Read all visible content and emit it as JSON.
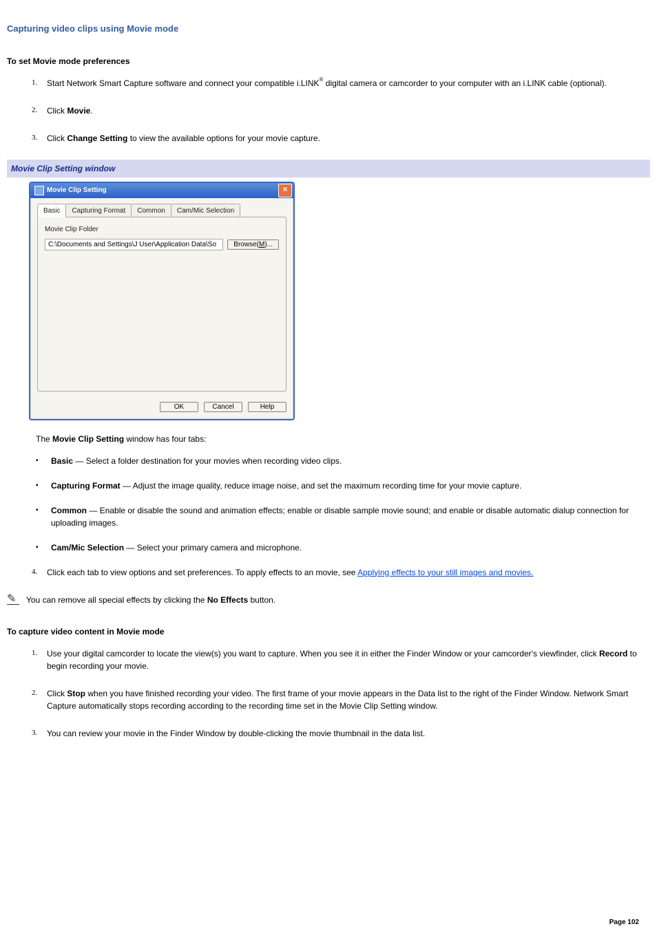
{
  "page_title": "Capturing video clips using Movie mode",
  "section1": {
    "heading": "To set Movie mode preferences",
    "step1_a": "Start Network Smart Capture software and connect your compatible i.LINK",
    "step1_reg": "®",
    "step1_b": " digital camera or camcorder to your computer with an i.LINK cable (optional).",
    "step2_a": "Click ",
    "step2_bold": "Movie",
    "step2_b": ".",
    "step3_a": "Click ",
    "step3_bold": "Change Setting",
    "step3_b": " to view the available options for your movie capture."
  },
  "caption": "Movie Clip Setting window",
  "dialog": {
    "title": "Movie Clip Setting",
    "tabs": {
      "t0": "Basic",
      "t1": "Capturing Format",
      "t2": "Common",
      "t3": "Cam/Mic Selection"
    },
    "group_label": "Movie Clip Folder",
    "folder_value": "C:\\Documents and Settings\\J User\\Application Data\\So",
    "browse_pre": "Browse(",
    "browse_u": "M",
    "browse_post": ")...",
    "ok": "OK",
    "cancel": "Cancel",
    "help": "Help"
  },
  "tabs_intro_a": "The ",
  "tabs_intro_bold": "Movie Clip Setting",
  "tabs_intro_b": " window has four tabs:",
  "tab_desc": {
    "basic_b": "Basic",
    "basic_t": " — Select a folder destination for your movies when recording video clips.",
    "cap_b": "Capturing Format",
    "cap_t": " — Adjust the image quality, reduce image noise, and set the maximum recording time for your movie capture.",
    "com_b": "Common",
    "com_t": " — Enable or disable the sound and animation effects; enable or disable sample movie sound; and enable or disable automatic dialup connection for uploading images.",
    "cam_b": "Cam/Mic Selection",
    "cam_t": " — Select your primary camera and microphone."
  },
  "step4_a": "Click each tab to view options and set preferences. To apply effects to an movie, see ",
  "step4_link": "Applying effects to your still images and movies.",
  "note_a": "You can remove all special effects by clicking the ",
  "note_bold": "No Effects",
  "note_b": " button.",
  "section2": {
    "heading": "To capture video content in Movie mode",
    "s1_a": "Use your digital camcorder to locate the view(s) you want to capture. When you see it in either the Finder Window or your camcorder's viewfinder, click ",
    "s1_bold": "Record",
    "s1_b": " to begin recording your movie.",
    "s2_a": "Click ",
    "s2_bold": "Stop",
    "s2_b": " when you have finished recording your video. The first frame of your movie appears in the Data list to the right of the Finder Window. Network Smart Capture automatically stops recording according to the recording time set in the Movie Clip Setting window.",
    "s3": "You can review your movie in the Finder Window by double-clicking the movie thumbnail in the data list."
  },
  "page_number": "Page 102"
}
